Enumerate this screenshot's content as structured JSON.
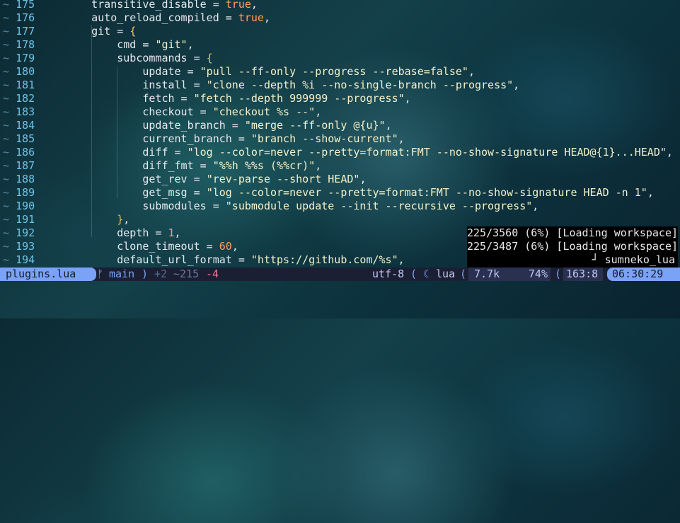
{
  "editor": {
    "lines": [
      {
        "n": "175",
        "t": [
          [
            "",
            "    transitive_disable = "
          ],
          [
            "kw",
            "true"
          ],
          [
            "",
            ","
          ]
        ]
      },
      {
        "n": "176",
        "t": [
          [
            "",
            "    auto_reload_compiled = "
          ],
          [
            "kw",
            "true"
          ],
          [
            "",
            ","
          ]
        ]
      },
      {
        "n": "177",
        "t": [
          [
            "",
            "    git = "
          ],
          [
            "brace",
            "{"
          ]
        ]
      },
      {
        "n": "178",
        "t": [
          [
            "",
            "        cmd = "
          ],
          [
            "str",
            "\"git\""
          ],
          [
            "",
            ","
          ]
        ]
      },
      {
        "n": "179",
        "t": [
          [
            "",
            "        subcommands = "
          ],
          [
            "brace",
            "{"
          ]
        ]
      },
      {
        "n": "180",
        "t": [
          [
            "",
            "            update = "
          ],
          [
            "str",
            "\"pull --ff-only --progress --rebase=false\""
          ],
          [
            "",
            ","
          ]
        ]
      },
      {
        "n": "181",
        "t": [
          [
            "",
            "            install = "
          ],
          [
            "str",
            "\"clone --depth %i --no-single-branch --progress\""
          ],
          [
            "",
            ","
          ]
        ]
      },
      {
        "n": "182",
        "t": [
          [
            "",
            "            fetch = "
          ],
          [
            "str",
            "\"fetch --depth 999999 --progress\""
          ],
          [
            "",
            ","
          ]
        ]
      },
      {
        "n": "183",
        "t": [
          [
            "",
            "            checkout = "
          ],
          [
            "str",
            "\"checkout %s --\""
          ],
          [
            "",
            ","
          ]
        ]
      },
      {
        "n": "184",
        "t": [
          [
            "",
            "            update_branch = "
          ],
          [
            "str",
            "\"merge --ff-only @{u}\""
          ],
          [
            "",
            ","
          ]
        ]
      },
      {
        "n": "185",
        "t": [
          [
            "",
            "            current_branch = "
          ],
          [
            "str",
            "\"branch --show-current\""
          ],
          [
            "",
            ","
          ]
        ]
      },
      {
        "n": "186",
        "t": [
          [
            "",
            "            diff = "
          ],
          [
            "str",
            "\"log --color=never --pretty=format:FMT --no-show-signature HEAD@{1}...HEAD\""
          ],
          [
            "",
            ","
          ]
        ]
      },
      {
        "n": "187",
        "t": [
          [
            "",
            "            diff_fmt = "
          ],
          [
            "str",
            "\"%%h %%s (%%cr)\""
          ],
          [
            "",
            ","
          ]
        ]
      },
      {
        "n": "188",
        "t": [
          [
            "",
            "            get_rev = "
          ],
          [
            "str",
            "\"rev-parse --short HEAD\""
          ],
          [
            "",
            ","
          ]
        ]
      },
      {
        "n": "189",
        "t": [
          [
            "",
            "            get_msg = "
          ],
          [
            "str",
            "\"log --color=never --pretty=format:FMT --no-show-signature HEAD -n 1\""
          ],
          [
            "",
            ","
          ]
        ]
      },
      {
        "n": "190",
        "t": [
          [
            "",
            "            submodules = "
          ],
          [
            "str",
            "\"submodule update --init --recursive --progress\""
          ],
          [
            "",
            ","
          ]
        ]
      },
      {
        "n": "191",
        "t": [
          [
            "brace",
            "        }"
          ],
          [
            "",
            ","
          ]
        ]
      },
      {
        "n": "192",
        "t": [
          [
            "",
            "        depth = "
          ],
          [
            "num-lit",
            "1"
          ],
          [
            "",
            ","
          ]
        ]
      },
      {
        "n": "193",
        "t": [
          [
            "",
            "        clone_timeout = "
          ],
          [
            "num-lit",
            "60"
          ],
          [
            "",
            ","
          ]
        ]
      },
      {
        "n": "194",
        "t": [
          [
            "",
            "        default_url_format = "
          ],
          [
            "str",
            "\"https://github.com/%s\""
          ],
          [
            "",
            ","
          ]
        ]
      }
    ],
    "gutter_marker": "~"
  },
  "notifications": [
    "225/3560 (6%) [Loading workspace]",
    "225/3487 (6%) [Loading workspace]",
    "┘ sumneko_lua"
  ],
  "statusbar": {
    "filename": "plugins.lua",
    "branch_icon": "ᚠ",
    "branch": "main",
    "diff_added": "+2",
    "diff_changed": "~215",
    "diff_removed": "-4",
    "encoding": "utf-8",
    "filetype_icon": "☾",
    "filetype": "lua",
    "size": "7.7k",
    "percent": "74%",
    "position": "163:8",
    "time": "06:30:29"
  },
  "colors": {
    "accent": "#7aa2f7",
    "string": "#f5f0c8",
    "number": "#ff9e64",
    "gutter": "#6ec3e8"
  }
}
